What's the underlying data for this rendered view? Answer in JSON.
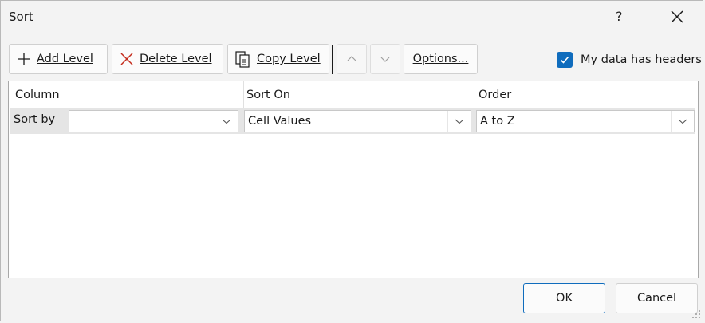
{
  "window": {
    "title": "Sort",
    "help": "?"
  },
  "toolbar": {
    "add_level": "Add Level",
    "delete_level": "Delete Level",
    "copy_level": "Copy Level",
    "options": "Options...",
    "headers_checkbox": {
      "label": "My data has headers",
      "checked": true
    }
  },
  "grid": {
    "headers": [
      "Column",
      "Sort On",
      "Order"
    ],
    "rows": [
      {
        "label": "Sort by",
        "column": "",
        "sort_on": "Cell Values",
        "order": "A to Z"
      }
    ]
  },
  "footer": {
    "ok": "OK",
    "cancel": "Cancel"
  },
  "colors": {
    "accent": "#0f6cbd",
    "delete_icon": "#c42b1c"
  }
}
